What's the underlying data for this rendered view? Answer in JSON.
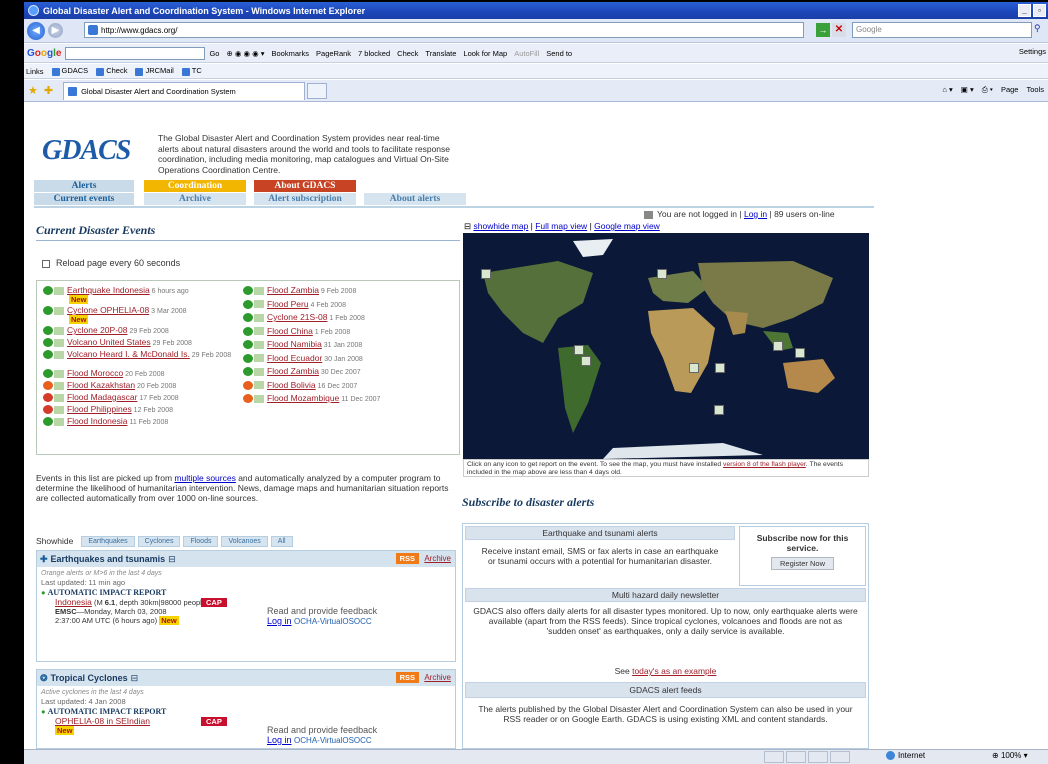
{
  "browser": {
    "window_title": "Global Disaster Alert and Coordination System - Windows Internet Explorer",
    "url": "http://www.gdacs.org/",
    "search_placeholder": "Google",
    "toolbar": {
      "go": "Go",
      "bookmarks": "Bookmarks",
      "pagerank": "PageRank",
      "blocked": "7 blocked",
      "check": "Check",
      "translate": "Translate",
      "look_for_map": "Look for Map",
      "autofill": "AutoFill",
      "send_to": "Send to",
      "settings": "Settings"
    },
    "links_label": "Links",
    "links": [
      "GDACS",
      "Check",
      "JRCMail",
      "TC"
    ],
    "tab_title": "Global Disaster Alert and Coordination System",
    "commands": {
      "page": "Page",
      "tools": "Tools"
    },
    "status": {
      "zone": "Internet",
      "zoom": "100%"
    }
  },
  "site": {
    "logo": "GDACS",
    "intro": "The Global Disaster Alert and Coordination System provides near real-time alerts about natural disasters around the world and tools to facilitate response coordination, including media monitoring, map catalogues and Virtual On-Site Operations Coordination Centre.",
    "nav_top": [
      "Alerts",
      "Coordination",
      "About GDACS"
    ],
    "nav_bottom": [
      "Current events",
      "Archive",
      "Alert subscription",
      "About alerts"
    ],
    "login": {
      "prefix": "You are not logged in | ",
      "link": "Log in",
      "suffix": " | 89 users on-line"
    }
  },
  "current": {
    "title": "Current Disaster Events",
    "reload": "Reload page every 60 seconds",
    "left_events": [
      {
        "name": "Earthquake Indonesia",
        "date": "6 hours ago",
        "new": "New",
        "level": "green"
      },
      {
        "name": "Cyclone OPHELIA-08",
        "date": "3 Mar 2008",
        "new": "New",
        "level": "green"
      },
      {
        "name": "Cyclone 20P-08",
        "date": "29 Feb 2008",
        "level": "green"
      },
      {
        "name": "Volcano United States",
        "date": "29 Feb 2008",
        "level": "green"
      },
      {
        "name": "Volcano Heard I. & McDonald Is.",
        "date": "29 Feb 2008",
        "level": "green"
      },
      {
        "name": "Flood Morocco",
        "date": "20 Feb 2008",
        "level": "green"
      },
      {
        "name": "Flood Kazakhstan",
        "date": "20 Feb 2008",
        "level": "orange"
      },
      {
        "name": "Flood Madagascar",
        "date": "17 Feb 2008",
        "level": "red"
      },
      {
        "name": "Flood Philippines",
        "date": "12 Feb 2008",
        "level": "red"
      },
      {
        "name": "Flood Indonesia",
        "date": "11 Feb 2008",
        "level": "green"
      }
    ],
    "right_events": [
      {
        "name": "Flood Zambia",
        "date": "9 Feb 2008",
        "level": "green"
      },
      {
        "name": "Flood Peru",
        "date": "4 Feb 2008",
        "level": "green"
      },
      {
        "name": "Cyclone 21S-08",
        "date": "1 Feb 2008",
        "level": "green"
      },
      {
        "name": "Flood China",
        "date": "1 Feb 2008",
        "level": "green"
      },
      {
        "name": "Flood Namibia",
        "date": "31 Jan 2008",
        "level": "green"
      },
      {
        "name": "Flood Ecuador",
        "date": "30 Jan 2008",
        "level": "green"
      },
      {
        "name": "Flood Zambia",
        "date": "30 Dec 2007",
        "level": "green"
      },
      {
        "name": "Flood Bolivia",
        "date": "16 Dec 2007",
        "level": "orange"
      },
      {
        "name": "Flood Mozambique",
        "date": "11 Dec 2007",
        "level": "orange"
      }
    ],
    "desc_a": "Events in this list are picked up from ",
    "desc_link": "multiple sources",
    "desc_b": " and automatically analyzed by a computer program to determine the likelihood of humanitarian intervention. News, damage maps and humanitarian situation reports are collected automatically from over 1000 on-line sources.",
    "showhide_label": "Showhide",
    "filters": [
      "Earthquakes",
      "Cyclones",
      "Floods",
      "Volcanoes",
      "All"
    ]
  },
  "eq_panel": {
    "title": "Earthquakes and tsunamis",
    "rss": "RSS",
    "archive": "Archive",
    "sub": "Orange alerts or M>6 in the last 4 days",
    "updated": "Last updated: 11 min ago",
    "report_title": "AUTOMATIC IMPACT REPORT",
    "cap": "CAP",
    "event_link": "Indonesia",
    "event_detail_a": " (M ",
    "magnitude": "6.1",
    "event_detail_b": ", depth 30km|98000 people)",
    "source": "EMSC",
    "source_date": "—Monday, March 03, 2008",
    "source_time": "2:37:00 AM UTC (6 hours ago)",
    "new": "New",
    "feedback": "Read and provide feedback",
    "login": "Log in",
    "ocha": "OCHA-VirtualOSOCC"
  },
  "tc_panel": {
    "title": "Tropical Cyclones",
    "rss": "RSS",
    "archive": "Archive",
    "sub": "Active cyclones in the last 4 days",
    "updated": "Last updated: 4 Jan 2008",
    "report_title": "AUTOMATIC IMPACT REPORT",
    "cap": "CAP",
    "event_link": "OPHELIA-08 in SEIndian",
    "new": "New",
    "feedback": "Read and provide feedback",
    "login": "Log in",
    "ocha": "OCHA-VirtualOSOCC"
  },
  "map": {
    "links": [
      "showhide map",
      "Full map view",
      "Google map view"
    ],
    "caption_a": "Click on any icon to get report on the event. To see the map, you must have installed ",
    "caption_link": "version 8 of the flash player",
    "caption_b": ". The events included in the map above are less than 4 days old."
  },
  "subscribe": {
    "title": "Subscribe to disaster alerts",
    "eq_head": "Earthquake and tsunami alerts",
    "eq_text": "Receive instant email, SMS or fax alerts in case an earthquake or tsunami occurs with a potential for humanitarian disaster.",
    "now_text": "Subscribe now for this service.",
    "register": "Register Now",
    "multi_head": "Multi hazard daily newsletter",
    "multi_text": "GDACS also offers daily alerts for all disaster types monitored. Up to now, only earthquake alerts were available (apart from the RSS feeds). Since tropical cyclones, volcanoes and floods are not as 'sudden onset' as earthquakes, only a daily service is available.",
    "see_a": "See ",
    "see_link": "today's as an example",
    "feeds_head": "GDACS alert feeds",
    "feeds_text": "The alerts published by the Global Disaster Alert and Coordination System can also be used in your RSS reader or on Google Earth. GDACS is using existing XML and content standards."
  }
}
